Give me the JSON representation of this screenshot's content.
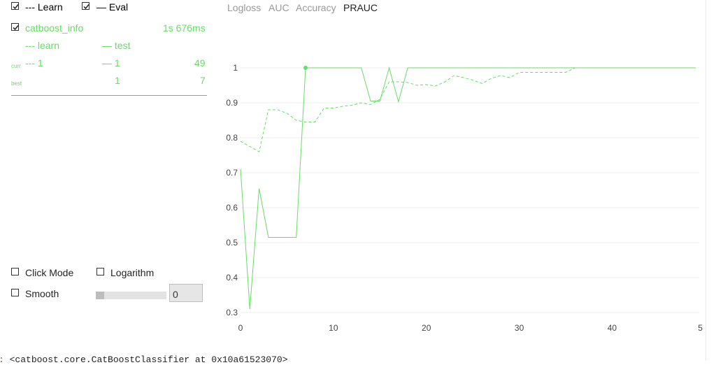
{
  "legend": {
    "learn_label": "--- Learn",
    "eval_label": "— Eval",
    "learn_checked": true,
    "eval_checked": true
  },
  "info": {
    "name": "catboost_info",
    "time": "1s 676ms",
    "col_learn": "--- learn",
    "col_test": "— test",
    "curr_label": "curr",
    "curr_learn": "--- 1",
    "curr_test": "— 1",
    "curr_iter": "49",
    "best_label": "best",
    "best_test": "1",
    "best_iter": "7"
  },
  "tabs": [
    {
      "label": "Logloss",
      "active": false
    },
    {
      "label": "AUC",
      "active": false
    },
    {
      "label": "Accuracy",
      "active": false
    },
    {
      "label": "PRAUC",
      "active": true
    }
  ],
  "options": {
    "click_mode_label": "Click Mode",
    "logarithm_label": "Logarithm",
    "smooth_label": "Smooth",
    "smooth_value": "0"
  },
  "console": {
    "text": "<catboost.core.CatBoostClassifier at 0x10a61523070>"
  },
  "chart_data": {
    "type": "line",
    "x_ticks": [
      0,
      10,
      20,
      30,
      40,
      5
    ],
    "y_ticks": [
      0.3,
      0.4,
      0.5,
      0.6,
      0.7,
      0.8,
      0.9,
      1
    ],
    "xlim": [
      0,
      49
    ],
    "ylim": [
      0.3,
      1.0
    ],
    "color": "#66dd66",
    "series": [
      {
        "name": "learn",
        "style": "dashed",
        "x": [
          0,
          1,
          2,
          3,
          4,
          5,
          6,
          7,
          8,
          9,
          10,
          11,
          12,
          13,
          14,
          15,
          16,
          17,
          18,
          19,
          20,
          21,
          22,
          23,
          24,
          25,
          26,
          27,
          28,
          29,
          30,
          31,
          32,
          33,
          34,
          35,
          36,
          37,
          38,
          39,
          40,
          41,
          42,
          43,
          44,
          45,
          46,
          47,
          48,
          49
        ],
        "y": [
          0.79,
          0.775,
          0.76,
          0.88,
          0.88,
          0.87,
          0.85,
          0.845,
          0.845,
          0.885,
          0.885,
          0.89,
          0.893,
          0.9,
          0.895,
          0.91,
          0.96,
          0.96,
          0.958,
          0.95,
          0.952,
          0.948,
          0.96,
          0.978,
          0.972,
          0.965,
          0.955,
          0.97,
          0.978,
          0.972,
          0.987,
          0.987,
          0.987,
          0.987,
          0.987,
          0.987,
          1.0,
          1.0,
          1.0,
          1.0,
          1.0,
          1.0,
          1.0,
          1.0,
          1.0,
          1.0,
          1.0,
          1.0,
          1.0,
          1.0
        ]
      },
      {
        "name": "test",
        "style": "solid",
        "best_iteration": 7,
        "x": [
          0,
          1,
          2,
          3,
          4,
          5,
          6,
          7,
          8,
          9,
          10,
          11,
          12,
          13,
          14,
          15,
          16,
          17,
          18,
          19,
          20,
          21,
          22,
          23,
          24,
          25,
          26,
          27,
          28,
          29,
          30,
          31,
          32,
          33,
          34,
          35,
          36,
          37,
          38,
          39,
          40,
          41,
          42,
          43,
          44,
          45,
          46,
          47,
          48,
          49
        ],
        "y": [
          0.71,
          0.31,
          0.655,
          0.515,
          0.515,
          0.515,
          0.515,
          1.0,
          1.0,
          1.0,
          1.0,
          1.0,
          1.0,
          1.0,
          0.905,
          0.905,
          1.0,
          0.903,
          1.0,
          1.0,
          1.0,
          1.0,
          1.0,
          1.0,
          1.0,
          1.0,
          1.0,
          1.0,
          1.0,
          1.0,
          1.0,
          1.0,
          1.0,
          1.0,
          1.0,
          1.0,
          1.0,
          1.0,
          1.0,
          1.0,
          1.0,
          1.0,
          1.0,
          1.0,
          1.0,
          1.0,
          1.0,
          1.0,
          1.0,
          1.0
        ]
      }
    ]
  }
}
